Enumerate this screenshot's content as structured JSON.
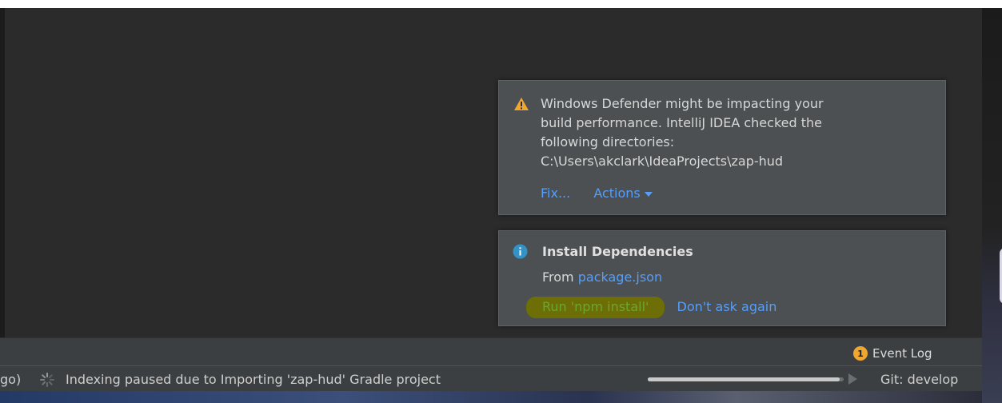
{
  "notifications": {
    "defender": {
      "icon": "warning-icon",
      "lines": [
        "Windows Defender might be impacting your",
        "build performance. IntelliJ IDEA checked the",
        "following directories:",
        "C:\\Users\\akclark\\IdeaProjects\\zap-hud"
      ],
      "fix_label": "Fix...",
      "actions_label": "Actions"
    },
    "install": {
      "icon": "info-icon",
      "title": "Install Dependencies",
      "from_prefix": "From",
      "from_link": "package.json",
      "run_label": "Run 'npm install'",
      "dont_ask_label": "Don't ask again"
    }
  },
  "tool_bar": {
    "event_count": "1",
    "event_log_label": "Event Log"
  },
  "status_bar": {
    "prefix": "go)",
    "indexing_text": "Indexing paused due to Importing 'zap-hud' Gradle project",
    "progress": 0.98,
    "git_branch": "Git: develop"
  },
  "colors": {
    "link": "#589df6",
    "warning": "#f0a732",
    "info": "#3592c4",
    "run_highlight": "#6d6f06"
  }
}
